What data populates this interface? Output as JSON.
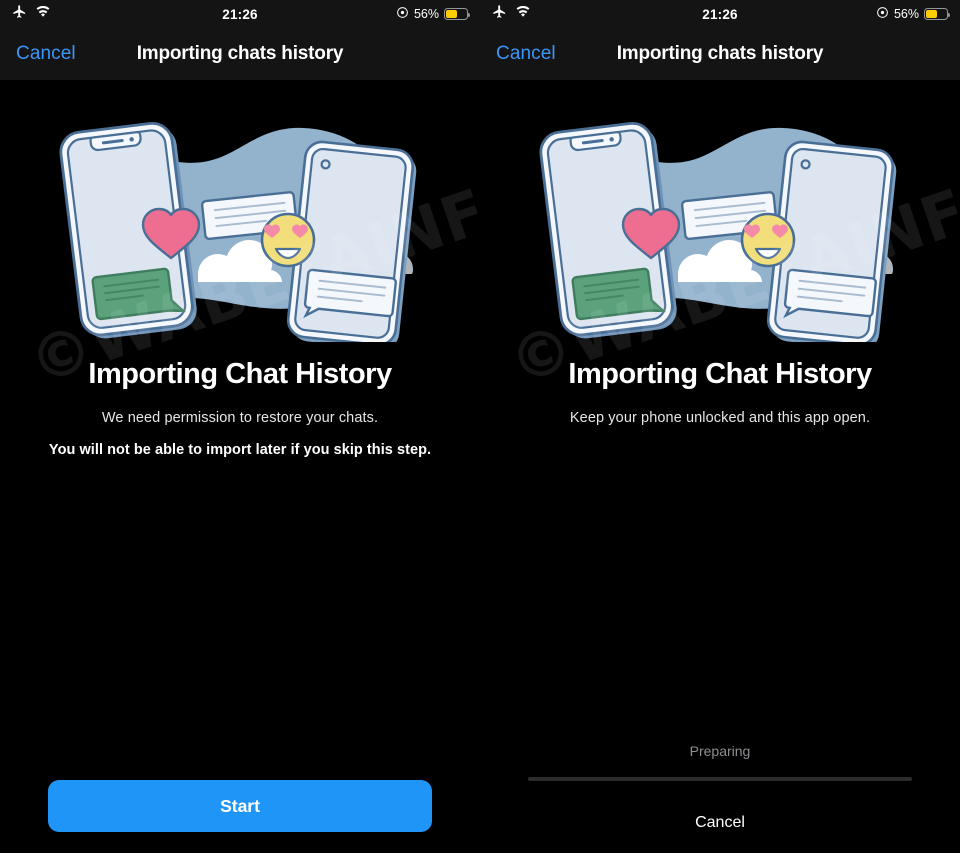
{
  "colors": {
    "accent": "#1e95f7",
    "link": "#3a97f8",
    "background": "#000000",
    "bar": "#141414",
    "battery_fill": "#ffcc00",
    "muted_text": "#8e8e93",
    "track": "#2c2c2e",
    "blob": "#93b3cd",
    "phone_screen": "#dde5f0",
    "phone_outline": "#4a6f96",
    "heart": "#ee6e91",
    "emoji": "#f2de7a",
    "bubble_green": "#5aa17c",
    "cloud": "#ffffff"
  },
  "watermark": "©WABETAINFO",
  "statusbar": {
    "time": "21:26",
    "battery_percent": "56%",
    "battery_level": 56,
    "icons": {
      "airplane": "airplane-mode-icon",
      "wifi": "wifi-icon",
      "lowpower": "low-power-icon",
      "battery": "battery-icon"
    }
  },
  "navbar": {
    "cancel_label": "Cancel",
    "title": "Importing chats history"
  },
  "illustration": {
    "name": "two-phones-chat-transfer-illustration",
    "elements": [
      "blob",
      "phone-left",
      "phone-right",
      "heart",
      "cloud",
      "emoji-heart-eyes",
      "chat-bubble-green",
      "chat-bubble-white-top",
      "chat-bubble-white-bottom"
    ]
  },
  "panels": [
    {
      "id": "permission",
      "heading": "Importing Chat History",
      "subtitle": "We need permission to restore your chats.",
      "warning": "You will not be able to import later if you skip this step.",
      "primary_button": "Start"
    },
    {
      "id": "progress",
      "heading": "Importing Chat History",
      "subtitle": "Keep your phone unlocked and this app open.",
      "progress_label": "Preparing",
      "progress_percent": 0,
      "cancel_button": "Cancel"
    }
  ]
}
